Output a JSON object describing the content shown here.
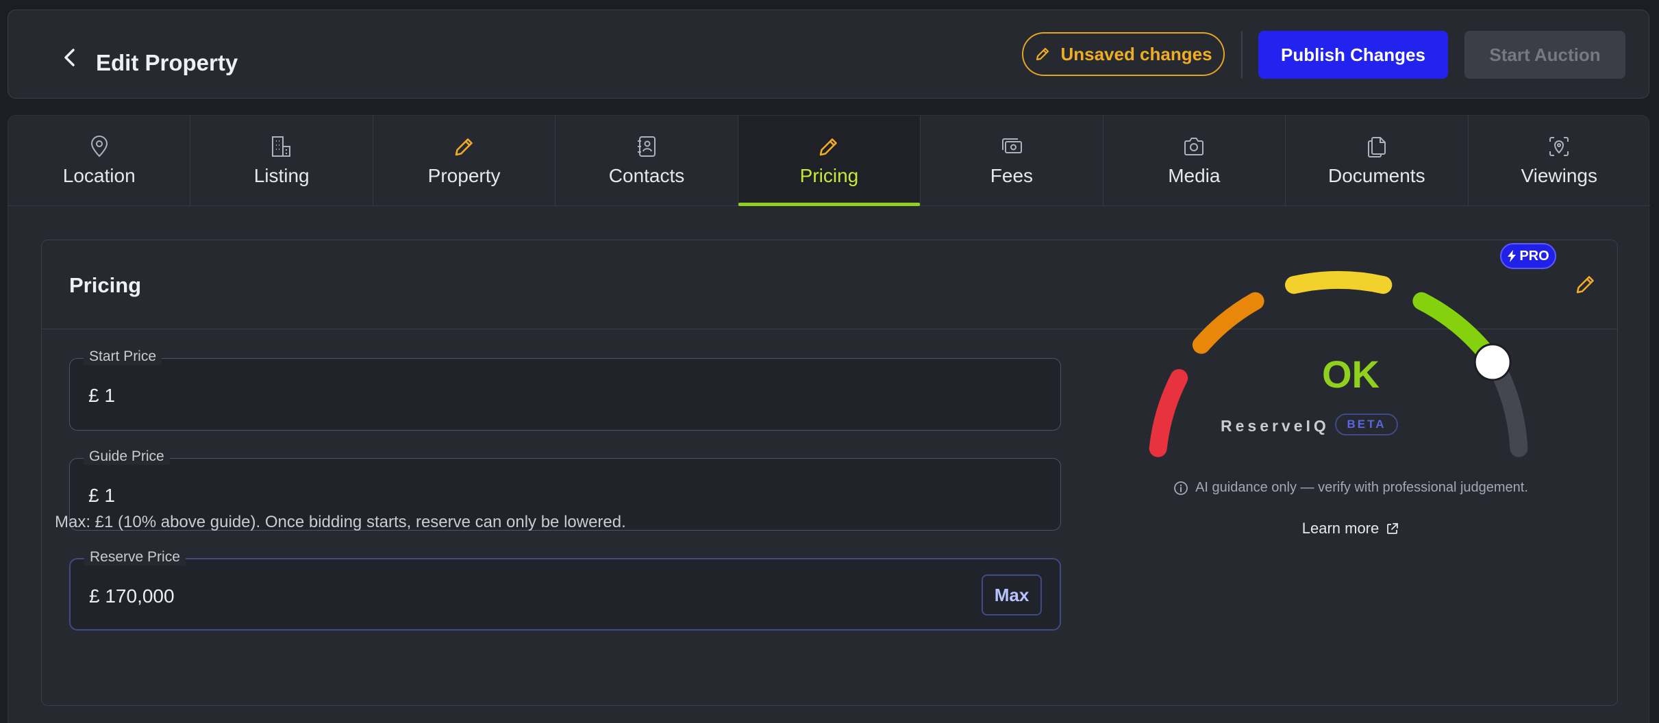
{
  "header": {
    "title": "Edit Property",
    "unsaved_label": "Unsaved changes",
    "publish_label": "Publish Changes",
    "auction_label": "Start Auction"
  },
  "tabs": [
    {
      "label": "Location",
      "icon": "map-pin-icon",
      "active": false
    },
    {
      "label": "Listing",
      "icon": "building-icon",
      "active": false
    },
    {
      "label": "Property",
      "icon": "pencil-icon",
      "active": false
    },
    {
      "label": "Contacts",
      "icon": "contact-book-icon",
      "active": false
    },
    {
      "label": "Pricing",
      "icon": "pencil-icon",
      "active": true
    },
    {
      "label": "Fees",
      "icon": "money-icon",
      "active": false
    },
    {
      "label": "Media",
      "icon": "camera-icon",
      "active": false
    },
    {
      "label": "Documents",
      "icon": "documents-icon",
      "active": false
    },
    {
      "label": "Viewings",
      "icon": "scan-location-icon",
      "active": false
    }
  ],
  "pricing": {
    "title": "Pricing",
    "start_price": {
      "label": "Start Price",
      "value": "£ 1"
    },
    "guide_price": {
      "label": "Guide Price",
      "value": "£ 1"
    },
    "reserve_price": {
      "label": "Reserve Price",
      "value": "£ 170,000",
      "max_label": "Max"
    },
    "helper_text": "Max: £1 (10% above guide). Once bidding starts, reserve can only be lowered."
  },
  "gauge": {
    "pro_label": "PRO",
    "status": "OK",
    "brand": "ReserveIQ",
    "beta_label": "BETA",
    "disclaimer": "AI guidance only — verify with professional judgement.",
    "learn_more": "Learn more",
    "level": 0.8
  },
  "colors": {
    "accent": "#8fd11c",
    "warning": "#e6a521",
    "primary": "#2323f0",
    "segments": [
      "#e8333f",
      "#e8870a",
      "#f2d12c",
      "#86d10e",
      "#444750"
    ]
  }
}
